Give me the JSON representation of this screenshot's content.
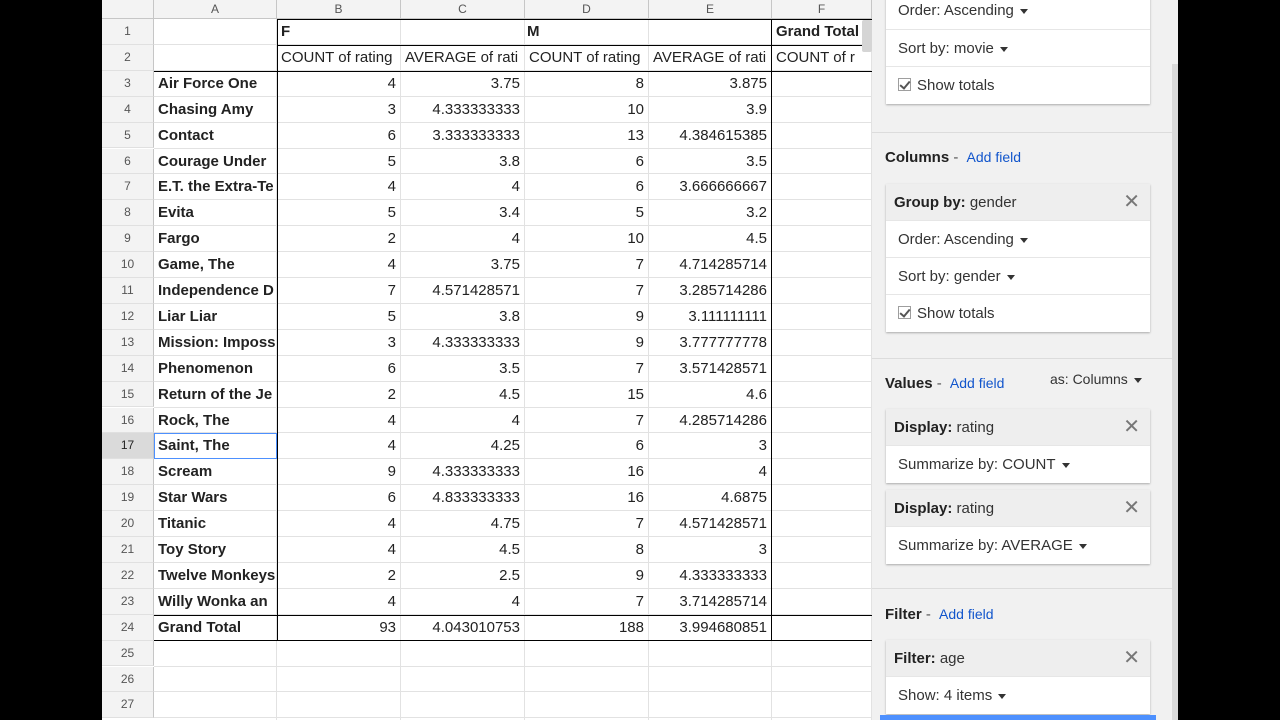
{
  "columns": [
    "A",
    "B",
    "C",
    "D",
    "E",
    "F"
  ],
  "header": {
    "gender_f": "F",
    "gender_m": "M",
    "grand_total": "Grand Total",
    "count_label": "COUNT of rating",
    "avg_label": "AVERAGE of rati",
    "count_label_cut": "COUNT of r"
  },
  "rows": [
    {
      "movie": "Air Force One",
      "f_count": "4",
      "f_avg": "3.75",
      "m_count": "8",
      "m_avg": "3.875"
    },
    {
      "movie": "Chasing Amy",
      "f_count": "3",
      "f_avg": "4.333333333",
      "m_count": "10",
      "m_avg": "3.9"
    },
    {
      "movie": "Contact",
      "f_count": "6",
      "f_avg": "3.333333333",
      "m_count": "13",
      "m_avg": "4.384615385"
    },
    {
      "movie": "Courage Under",
      "f_count": "5",
      "f_avg": "3.8",
      "m_count": "6",
      "m_avg": "3.5"
    },
    {
      "movie": "E.T. the Extra-Te",
      "f_count": "4",
      "f_avg": "4",
      "m_count": "6",
      "m_avg": "3.666666667"
    },
    {
      "movie": "Evita",
      "f_count": "5",
      "f_avg": "3.4",
      "m_count": "5",
      "m_avg": "3.2"
    },
    {
      "movie": "Fargo",
      "f_count": "2",
      "f_avg": "4",
      "m_count": "10",
      "m_avg": "4.5"
    },
    {
      "movie": "Game, The",
      "f_count": "4",
      "f_avg": "3.75",
      "m_count": "7",
      "m_avg": "4.714285714"
    },
    {
      "movie": "Independence D",
      "f_count": "7",
      "f_avg": "4.571428571",
      "m_count": "7",
      "m_avg": "3.285714286"
    },
    {
      "movie": "Liar Liar",
      "f_count": "5",
      "f_avg": "3.8",
      "m_count": "9",
      "m_avg": "3.111111111"
    },
    {
      "movie": "Mission: Imposs",
      "f_count": "3",
      "f_avg": "4.333333333",
      "m_count": "9",
      "m_avg": "3.777777778"
    },
    {
      "movie": "Phenomenon",
      "f_count": "6",
      "f_avg": "3.5",
      "m_count": "7",
      "m_avg": "3.571428571"
    },
    {
      "movie": "Return of the Je",
      "f_count": "2",
      "f_avg": "4.5",
      "m_count": "15",
      "m_avg": "4.6"
    },
    {
      "movie": "Rock, The",
      "f_count": "4",
      "f_avg": "4",
      "m_count": "7",
      "m_avg": "4.285714286"
    },
    {
      "movie": "Saint, The",
      "f_count": "4",
      "f_avg": "4.25",
      "m_count": "6",
      "m_avg": "3"
    },
    {
      "movie": "Scream",
      "f_count": "9",
      "f_avg": "4.333333333",
      "m_count": "16",
      "m_avg": "4"
    },
    {
      "movie": "Star Wars",
      "f_count": "6",
      "f_avg": "4.833333333",
      "m_count": "16",
      "m_avg": "4.6875"
    },
    {
      "movie": "Titanic",
      "f_count": "4",
      "f_avg": "4.75",
      "m_count": "7",
      "m_avg": "4.571428571"
    },
    {
      "movie": "Toy Story",
      "f_count": "4",
      "f_avg": "4.5",
      "m_count": "8",
      "m_avg": "3"
    },
    {
      "movie": "Twelve Monkeys",
      "f_count": "2",
      "f_avg": "2.5",
      "m_count": "9",
      "m_avg": "4.333333333"
    },
    {
      "movie": "Willy Wonka an",
      "f_count": "4",
      "f_avg": "4",
      "m_count": "7",
      "m_avg": "3.714285714"
    }
  ],
  "grand_total": {
    "label": "Grand Total",
    "f_count": "93",
    "f_avg": "4.043010753",
    "m_count": "188",
    "m_avg": "3.994680851"
  },
  "selected_row": 17,
  "row_count": 27,
  "panel": {
    "rows_card": {
      "order": "Order: Ascending",
      "sort": "Sort by: movie",
      "totals": "Show totals"
    },
    "columns_section": {
      "title": "Columns",
      "add": "Add field"
    },
    "columns_card": {
      "group_label": "Group by:",
      "group_value": "gender",
      "order": "Order: Ascending",
      "sort": "Sort by: gender",
      "totals": "Show totals"
    },
    "values_section": {
      "title": "Values",
      "add": "Add field",
      "as": "as: Columns"
    },
    "values_card_1": {
      "display_label": "Display:",
      "display_value": "rating",
      "summarize": "Summarize by: COUNT"
    },
    "values_card_2": {
      "display_label": "Display:",
      "display_value": "rating",
      "summarize": "Summarize by: AVERAGE"
    },
    "filter_section": {
      "title": "Filter",
      "add": "Add field"
    },
    "filter_card": {
      "filter_label": "Filter:",
      "filter_value": "age",
      "show": "Show: 4 items"
    }
  }
}
